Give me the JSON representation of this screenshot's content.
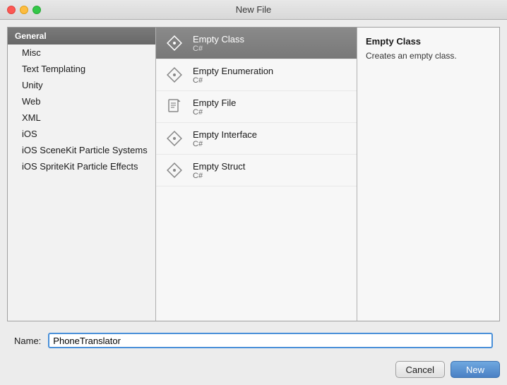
{
  "titleBar": {
    "title": "New File"
  },
  "leftPanel": {
    "header": "General",
    "items": [
      "Misc",
      "Text Templating",
      "Unity",
      "Web",
      "XML",
      "iOS",
      "iOS SceneKit Particle Systems",
      "iOS SpriteKit Particle Effects"
    ]
  },
  "middlePanel": {
    "templates": [
      {
        "title": "Empty Class",
        "subtitle": "C#",
        "iconType": "diamond",
        "selected": true
      },
      {
        "title": "Empty Enumeration",
        "subtitle": "C#",
        "iconType": "diamond",
        "selected": false
      },
      {
        "title": "Empty File",
        "subtitle": "C#",
        "iconType": "file",
        "selected": false
      },
      {
        "title": "Empty Interface",
        "subtitle": "C#",
        "iconType": "diamond",
        "selected": false
      },
      {
        "title": "Empty Struct",
        "subtitle": "C#",
        "iconType": "diamond",
        "selected": false
      }
    ]
  },
  "rightPanel": {
    "title": "Empty Class",
    "description": "Creates an empty class."
  },
  "bottomBar": {
    "nameLabel": "Name:",
    "nameValue": "PhoneTranslator"
  },
  "buttons": {
    "cancel": "Cancel",
    "new": "New"
  }
}
